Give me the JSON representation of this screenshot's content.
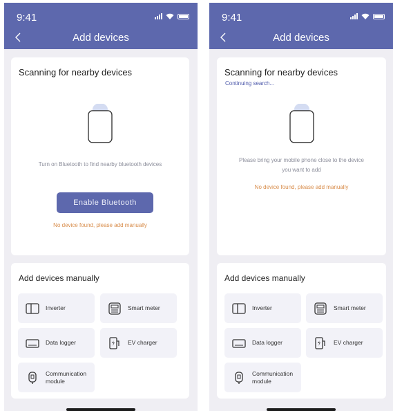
{
  "screens": [
    {
      "status_time": "9:41",
      "title": "Add devices",
      "scan_title": "Scanning for nearby devices",
      "message": "Turn on Bluetooth to find nearby bluetooth devices",
      "enable_button": "Enable Bluetooth",
      "no_device": "No device found, please add manually",
      "manual_title": "Add devices manually",
      "devices": [
        "Inverter",
        "Smart meter",
        "Data logger",
        "EV charger",
        "Communication module"
      ]
    },
    {
      "status_time": "9:41",
      "title": "Add devices",
      "scan_title": "Scanning for nearby devices",
      "scan_sub": "Continuing search...",
      "message": "Please bring your mobile phone close to the device you want to add",
      "no_device": "No device found, please add manually",
      "manual_title": "Add devices manually",
      "devices": [
        "Inverter",
        "Smart meter",
        "Data logger",
        "EV charger",
        "Communication module"
      ]
    }
  ],
  "colors": {
    "accent": "#5d68ad",
    "warning": "#d88c4a",
    "background": "#efeef3"
  }
}
